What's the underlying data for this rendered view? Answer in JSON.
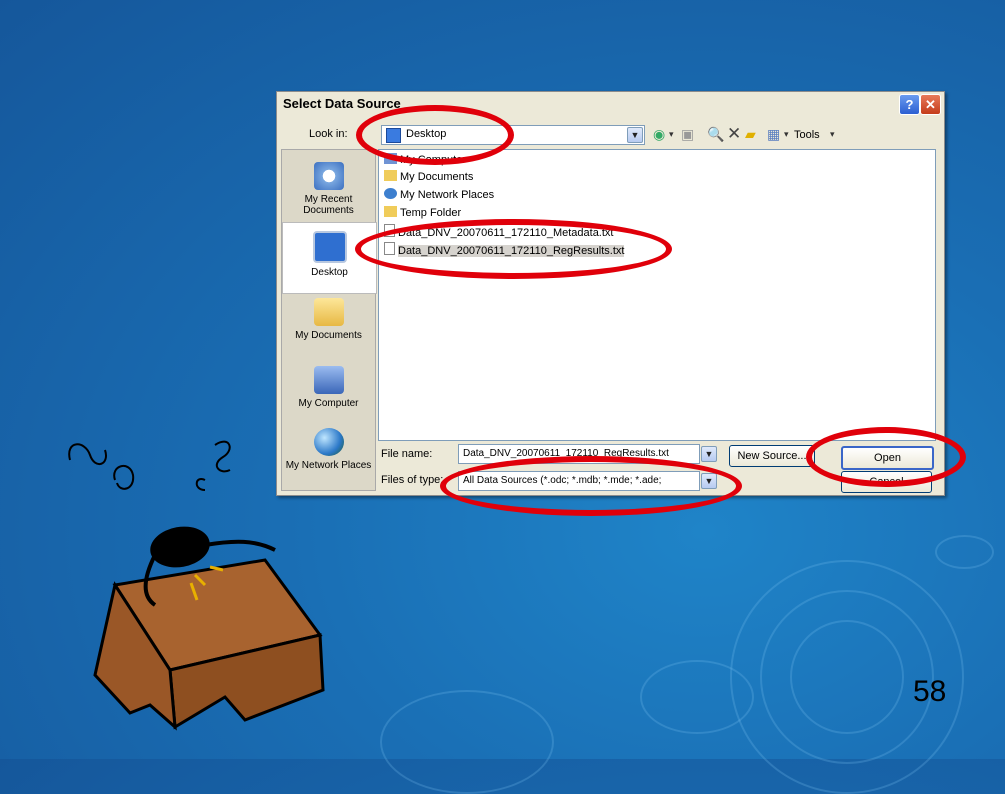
{
  "dialog": {
    "title": "Select Data Source",
    "look_in_label": "Look in:",
    "look_in_value": "Desktop",
    "tools_label": "Tools",
    "places": [
      {
        "label": "My Recent Documents"
      },
      {
        "label": "Desktop"
      },
      {
        "label": "My Documents"
      },
      {
        "label": "My Computer"
      },
      {
        "label": "My Network Places"
      }
    ],
    "files": [
      {
        "name": "My Computer"
      },
      {
        "name": "My Documents"
      },
      {
        "name": "My Network Places"
      },
      {
        "name": "Temp Folder"
      },
      {
        "name": "Data_DNV_20070611_172110_Metadata.txt"
      },
      {
        "name": "Data_DNV_20070611_172110_RegResults.txt"
      }
    ],
    "file_name_label": "File name:",
    "file_name_value": "Data_DNV_20070611_172110_RegResults.txt",
    "files_of_type_label": "Files of type:",
    "files_of_type_value": "All Data Sources (*.odc; *.mdb; *.mde; *.ade;",
    "new_source_label": "New Source...",
    "open_label": "Open",
    "cancel_label": "Cancel"
  },
  "slide_number": "58",
  "colors": {
    "highlight_oval": "#e0000a",
    "background": "#1a6fb5"
  }
}
